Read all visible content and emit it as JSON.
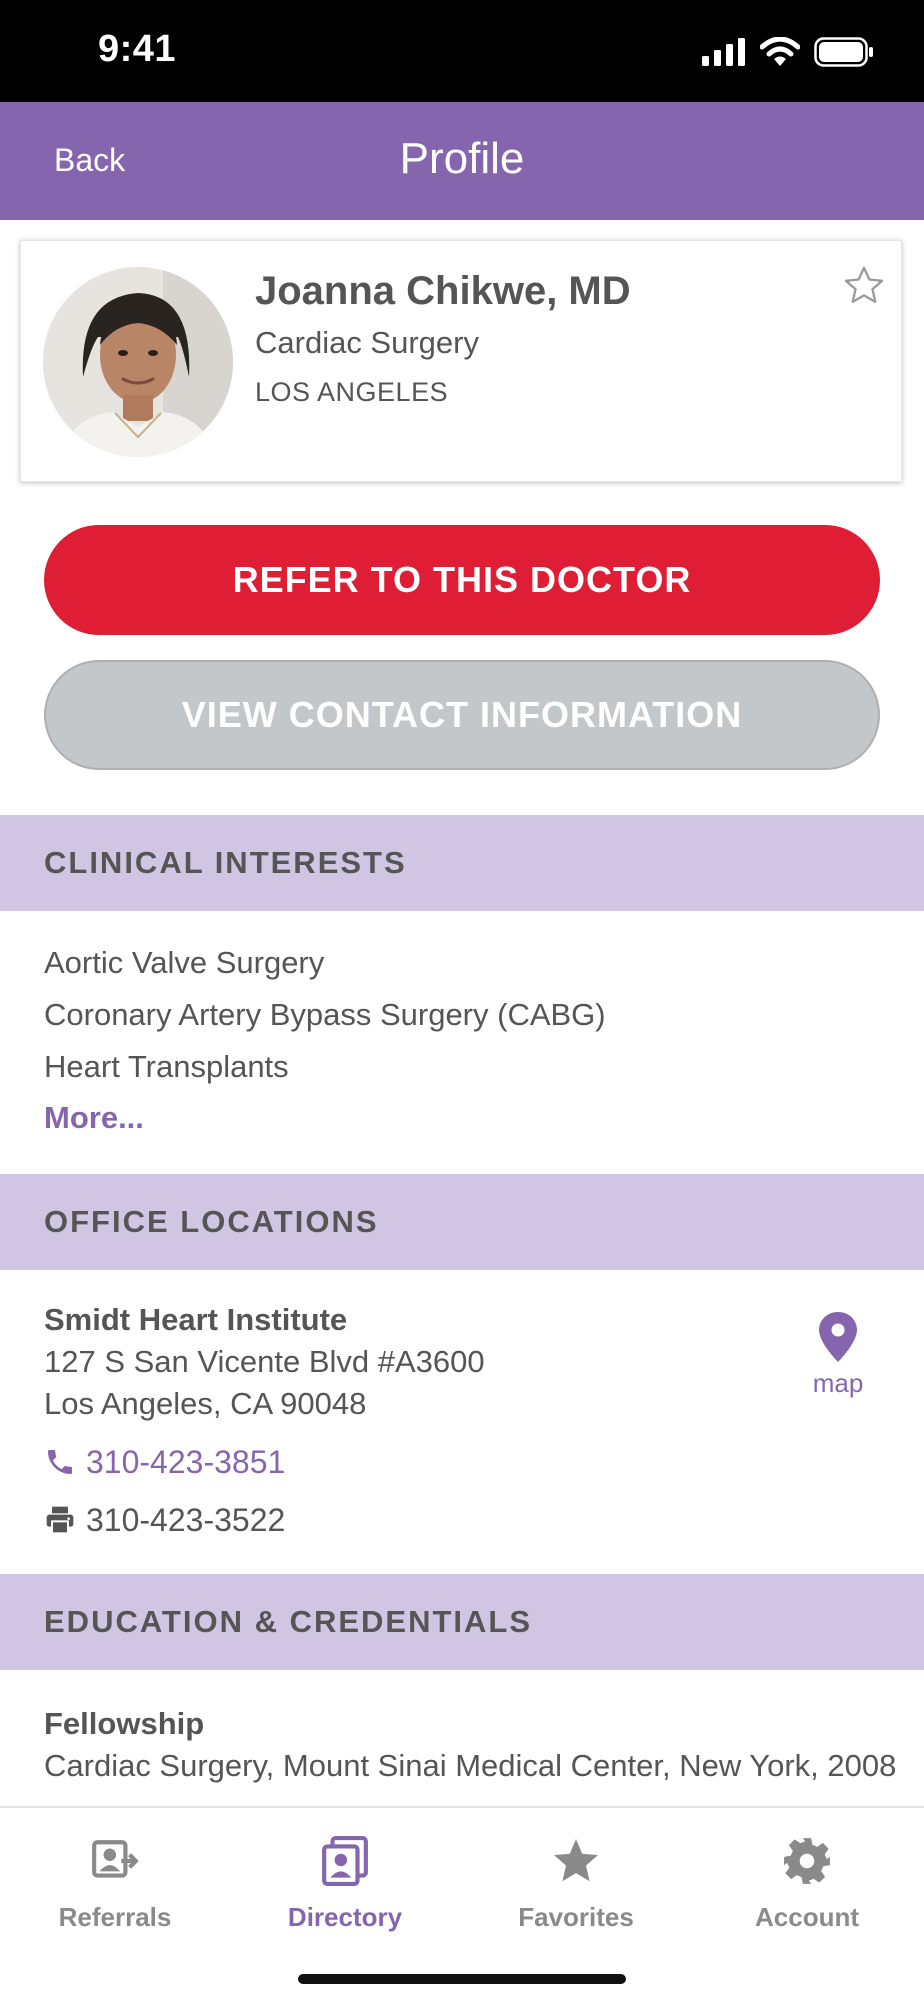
{
  "status": {
    "time": "9:41"
  },
  "nav": {
    "back_label": "Back",
    "title": "Profile"
  },
  "doctor": {
    "name": "Joanna Chikwe, MD",
    "specialty": "Cardiac Surgery",
    "city": "LOS ANGELES",
    "favorite": false
  },
  "actions": {
    "refer_label": "REFER TO THIS DOCTOR",
    "contact_label": "VIEW CONTACT INFORMATION"
  },
  "clinical_interests": {
    "header": "CLINICAL INTERESTS",
    "items": [
      "Aortic Valve Surgery",
      "Coronary Artery Bypass Surgery (CABG)",
      "Heart Transplants"
    ],
    "more_label": "More..."
  },
  "office_locations": {
    "header": "OFFICE LOCATIONS",
    "name": "Smidt Heart Institute",
    "address_line1": "127 S San Vicente Blvd #A3600",
    "address_line2": "Los Angeles, CA 90048",
    "phone": "310-423-3851",
    "fax": "310-423-3522",
    "map_label": "map"
  },
  "education": {
    "header": "EDUCATION & CREDENTIALS",
    "title": "Fellowship",
    "detail": "Cardiac Surgery, Mount Sinai Medical Center, New York, 2008"
  },
  "tabs": [
    {
      "label": "Referrals",
      "icon": "referrals-icon",
      "active": false
    },
    {
      "label": "Directory",
      "icon": "directory-icon",
      "active": true
    },
    {
      "label": "Favorites",
      "icon": "star-icon",
      "active": false
    },
    {
      "label": "Account",
      "icon": "gear-icon",
      "active": false
    }
  ],
  "colors": {
    "brand_purple": "#8566ae",
    "section_lavender": "#d0c6e3",
    "refer_red": "#df1e35",
    "disabled_gray": "#c4c7ca"
  }
}
